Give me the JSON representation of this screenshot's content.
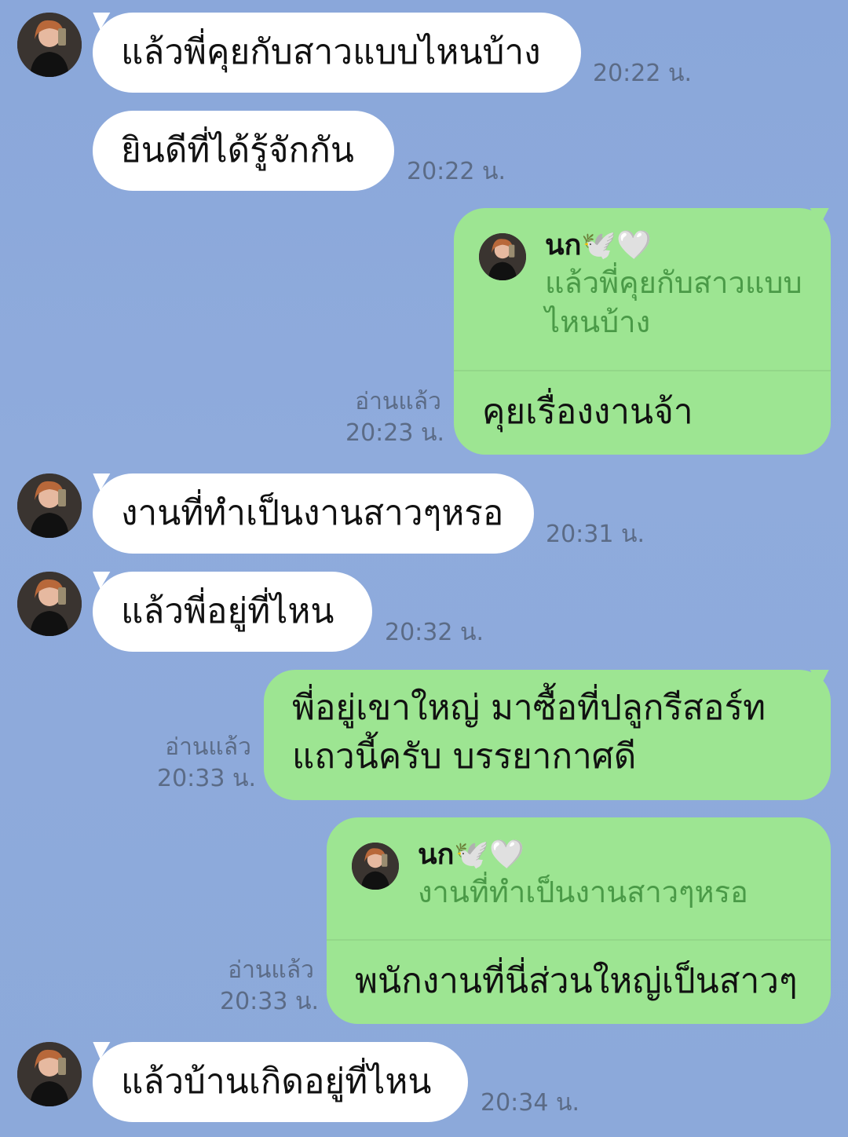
{
  "contact": {
    "name": "นก🕊️🤍"
  },
  "messages": [
    {
      "type": "in",
      "text": "แล้วพี่คุยกับสาวแบบไหนบ้าง",
      "time": "20:22 น."
    },
    {
      "type": "in",
      "text": "ยินดีที่ได้รู้จักกัน",
      "time": "20:22 น."
    },
    {
      "type": "out-reply",
      "quote_name": "นก🕊️🤍",
      "quote_text": "แล้วพี่คุยกับสาวแบบไหนบ้าง",
      "text": "คุยเรื่องงานจ้า",
      "read": "อ่านแล้ว",
      "time": "20:23 น."
    },
    {
      "type": "in",
      "text": "งานที่ทำเป็นงานสาวๆหรอ",
      "time": "20:31 น."
    },
    {
      "type": "in",
      "text": "แล้วพี่อยู่ที่ไหน",
      "time": "20:32 น."
    },
    {
      "type": "out",
      "text": "พี่อยู่เขาใหญ่ มาซื้อที่ปลูกรีสอร์ท แถวนี้ครับ บรรยากาศดี",
      "read": "อ่านแล้ว",
      "time": "20:33 น."
    },
    {
      "type": "out-reply",
      "quote_name": "นก🕊️🤍",
      "quote_text": "งานที่ทำเป็นงานสาวๆหรอ",
      "text": "พนักงานที่นี่ส่วนใหญ่เป็นสาวๆ",
      "read": "อ่านแล้ว",
      "time": "20:33 น."
    },
    {
      "type": "in",
      "text": "แล้วบ้านเกิดอยู่ที่ไหน",
      "time": "20:34 น."
    }
  ],
  "colors": {
    "background": "#8eaad9",
    "incoming": "#ffffff",
    "outgoing": "#9de592",
    "quote_text": "#4a9a47",
    "meta": "#5b6b86"
  }
}
